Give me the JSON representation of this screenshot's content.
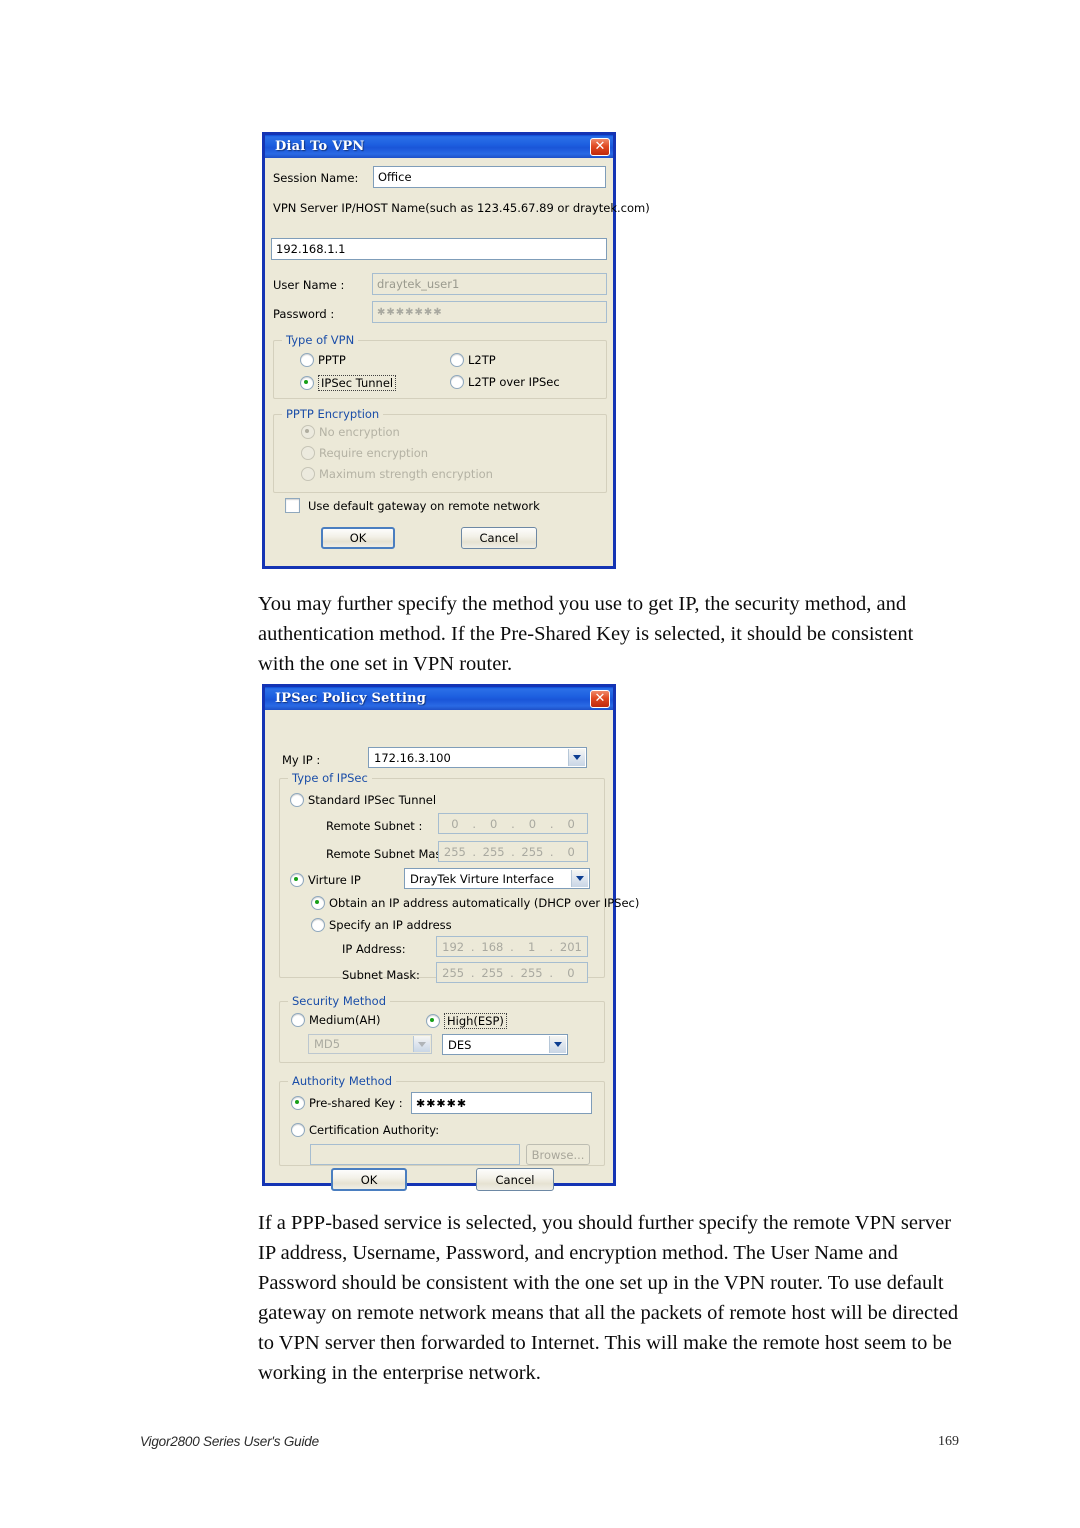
{
  "document": {
    "footer_left": "Vigor2800 Series User's Guide",
    "footer_right": "169"
  },
  "paragraphs": {
    "p1": "You may further specify the method you use to get IP, the security method, and authentication method. If the Pre-Shared Key is selected, it should be consistent with the one set in VPN router.",
    "p2": "If a PPP-based service is selected, you should further specify the remote VPN server IP address, Username, Password, and encryption method. The User Name and Password should be consistent with the one set up in the VPN router. To use default gateway on remote network means that all the packets of remote host will be directed to VPN server then forwarded to Internet. This will make the remote host seem to be working in the enterprise network."
  },
  "dial_to_vpn": {
    "title": "Dial To VPN",
    "close_label": "✕",
    "session_name_label": "Session Name:",
    "session_name_value": "Office",
    "vpn_server_hint": "VPN Server IP/HOST Name(such as 123.45.67.89 or draytek.com)",
    "vpn_server_value": "192.168.1.1",
    "user_name_label": "User Name :",
    "user_name_value": "draytek_user1",
    "password_label": "Password :",
    "password_value": "✱✱✱✱✱✱✱",
    "type_of_vpn": {
      "group_title": "Type of VPN",
      "options": [
        {
          "label": "PPTP",
          "checked": false
        },
        {
          "label": "L2TP",
          "checked": false
        },
        {
          "label": "IPSec Tunnel",
          "checked": true
        },
        {
          "label": "L2TP over IPSec",
          "checked": false
        }
      ]
    },
    "pptp_encryption": {
      "group_title": "PPTP Encryption",
      "options": [
        {
          "label": "No encryption",
          "checked": true
        },
        {
          "label": "Require encryption",
          "checked": false
        },
        {
          "label": "Maximum strength encryption",
          "checked": false
        }
      ]
    },
    "default_gateway_label": "Use default gateway on remote network",
    "default_gateway_checked": false,
    "ok_label": "OK",
    "cancel_label": "Cancel"
  },
  "ipsec_policy": {
    "title": "IPSec Policy Setting",
    "close_label": "✕",
    "my_ip_label": "My IP :",
    "my_ip_value": "172.16.3.100",
    "type_of_ipsec": {
      "group_title": "Type of IPSec",
      "standard_label": "Standard IPSec Tunnel",
      "standard_checked": false,
      "remote_subnet_label": "Remote Subnet :",
      "remote_subnet_value": [
        "0",
        "0",
        "0",
        "0"
      ],
      "remote_subnet_mask_label": "Remote Subnet Mask :",
      "remote_subnet_mask_value": [
        "255",
        "255",
        "255",
        "0"
      ],
      "virture_ip_label": "Virture IP",
      "virture_ip_checked": true,
      "virture_interface_value": "DrayTek Virture Interface",
      "obtain_auto_label": "Obtain an IP address automatically (DHCP over IPSec)",
      "obtain_auto_checked": true,
      "specify_ip_label": "Specify an IP address",
      "specify_ip_checked": false,
      "ip_address_label": "IP Address:",
      "ip_address_value": [
        "192",
        "168",
        "1",
        "201"
      ],
      "subnet_mask_label": "Subnet Mask:",
      "subnet_mask_value": [
        "255",
        "255",
        "255",
        "0"
      ]
    },
    "security_method": {
      "group_title": "Security Method",
      "medium_label": "Medium(AH)",
      "medium_checked": false,
      "medium_combo_value": "MD5",
      "high_label": "High(ESP)",
      "high_checked": true,
      "high_combo_value": "DES"
    },
    "authority_method": {
      "group_title": "Authority Method",
      "preshared_label": "Pre-shared Key :",
      "preshared_checked": true,
      "preshared_value": "✱✱✱✱✱",
      "ca_label": "Certification Authority:",
      "ca_checked": false,
      "ca_value": "",
      "browse_label": "Browse..."
    },
    "ok_label": "OK",
    "cancel_label": "Cancel"
  }
}
